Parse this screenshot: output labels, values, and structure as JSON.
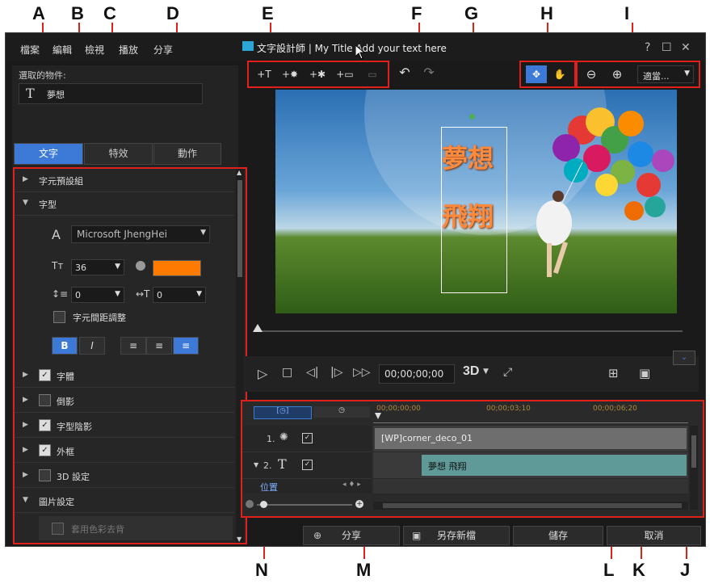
{
  "callouts": [
    "A",
    "B",
    "C",
    "D",
    "E",
    "F",
    "G",
    "H",
    "I",
    "J",
    "K",
    "L",
    "M",
    "N"
  ],
  "menu": [
    "檔案",
    "編輯",
    "檢視",
    "播放",
    "分享"
  ],
  "title_text": "文字設計師 | My Title Add your text here",
  "window_controls": [
    "?",
    "☐",
    "✕"
  ],
  "selected_object_label": "選取的物件:",
  "selected_object_value": "夢想",
  "tabs": [
    "文字",
    "特效",
    "動作"
  ],
  "props": {
    "preset_group": "字元預設組",
    "font_section": "字型",
    "font_name": "Microsoft JhengHei",
    "font_size": "36",
    "font_color": "#ff7a00",
    "line_spacing": "0",
    "char_spacing": "0",
    "kerning_label": "字元間距調整",
    "bold": "B",
    "italic": "I",
    "items": [
      {
        "label": "字體",
        "checked": true
      },
      {
        "label": "倒影",
        "checked": false
      },
      {
        "label": "字型陰影",
        "checked": true
      },
      {
        "label": "外框",
        "checked": true
      },
      {
        "label": "3D 設定",
        "checked": false
      }
    ],
    "image_settings": "圖片設定",
    "image_sub": "套用色彩去背"
  },
  "toolbar": {
    "insert_text": "+T",
    "insert_particle": "+✸",
    "insert_effect": "+✱",
    "insert_image": "+▭",
    "undo": "↶",
    "redo": "↷",
    "move": "✥",
    "hand": "✋",
    "zoom_out": "⊖",
    "zoom_in": "⊕",
    "fit": "適當..."
  },
  "preview_text": {
    "line1": "夢想",
    "line2": "飛翔"
  },
  "playback": {
    "timecode": "00;00;00;00",
    "threeD": "3D"
  },
  "timeline": {
    "ruler": [
      "00;00;00;00",
      "00;00;03;10",
      "00;00;06;20"
    ],
    "tracks": [
      {
        "num": "1.",
        "clip": "[WP]corner_deco_01"
      },
      {
        "num": "2.",
        "clip": "夢想 飛翔"
      }
    ],
    "position_label": "位置"
  },
  "bottom": {
    "share": "分享",
    "save_as": "另存新檔",
    "save": "儲存",
    "cancel": "取消"
  },
  "colors": {
    "accent_red": "#e0201a",
    "highlight_blue": "#3d7ad8",
    "orange_text": "#ff7a00"
  }
}
